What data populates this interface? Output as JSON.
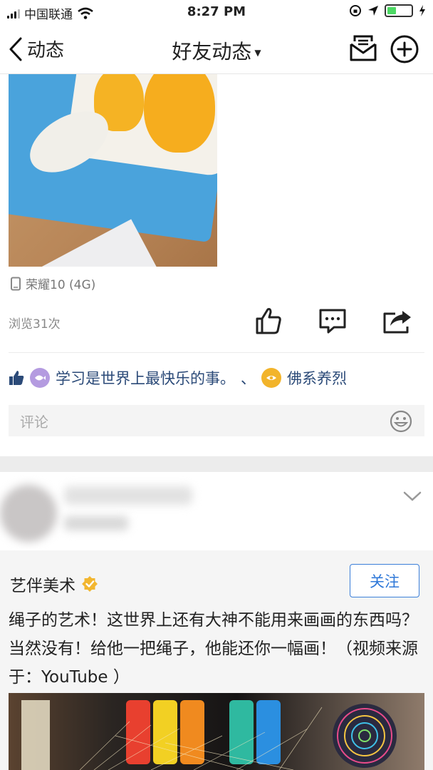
{
  "status": {
    "carrier": "中国联通",
    "time": "8:27 PM"
  },
  "nav": {
    "back_label": "动态",
    "title": "好友动态"
  },
  "post1": {
    "device": "荣耀10 (4G)",
    "views": "浏览31次",
    "likes": {
      "user1": "学习是世界上最快乐的事。",
      "separator": "、",
      "user2": "佛系养烈"
    },
    "comment_placeholder": "评论"
  },
  "post2": {
    "author": "艺伴美术",
    "follow_label": "关注",
    "text": "绳子的艺术！这世界上还有大神不能用来画画的东西吗？当然没有！给他一把绳子，他能还你一幅画！（视频来源于：YouTube ）"
  },
  "colors": {
    "accent": "#2f78d8",
    "like_blue": "#2b4a78",
    "battery_green": "#4cd964",
    "verified": "#f2b630"
  },
  "icons": [
    "signal-icon",
    "wifi-icon",
    "lock-rotation-icon",
    "location-icon",
    "battery-icon",
    "back-arrow-icon",
    "dropdown-caret-icon",
    "inbox-icon",
    "add-icon",
    "phone-icon",
    "like-icon",
    "comment-icon",
    "share-icon",
    "thumb-icon",
    "emoji-icon",
    "chevron-down-icon",
    "verified-badge-icon"
  ]
}
